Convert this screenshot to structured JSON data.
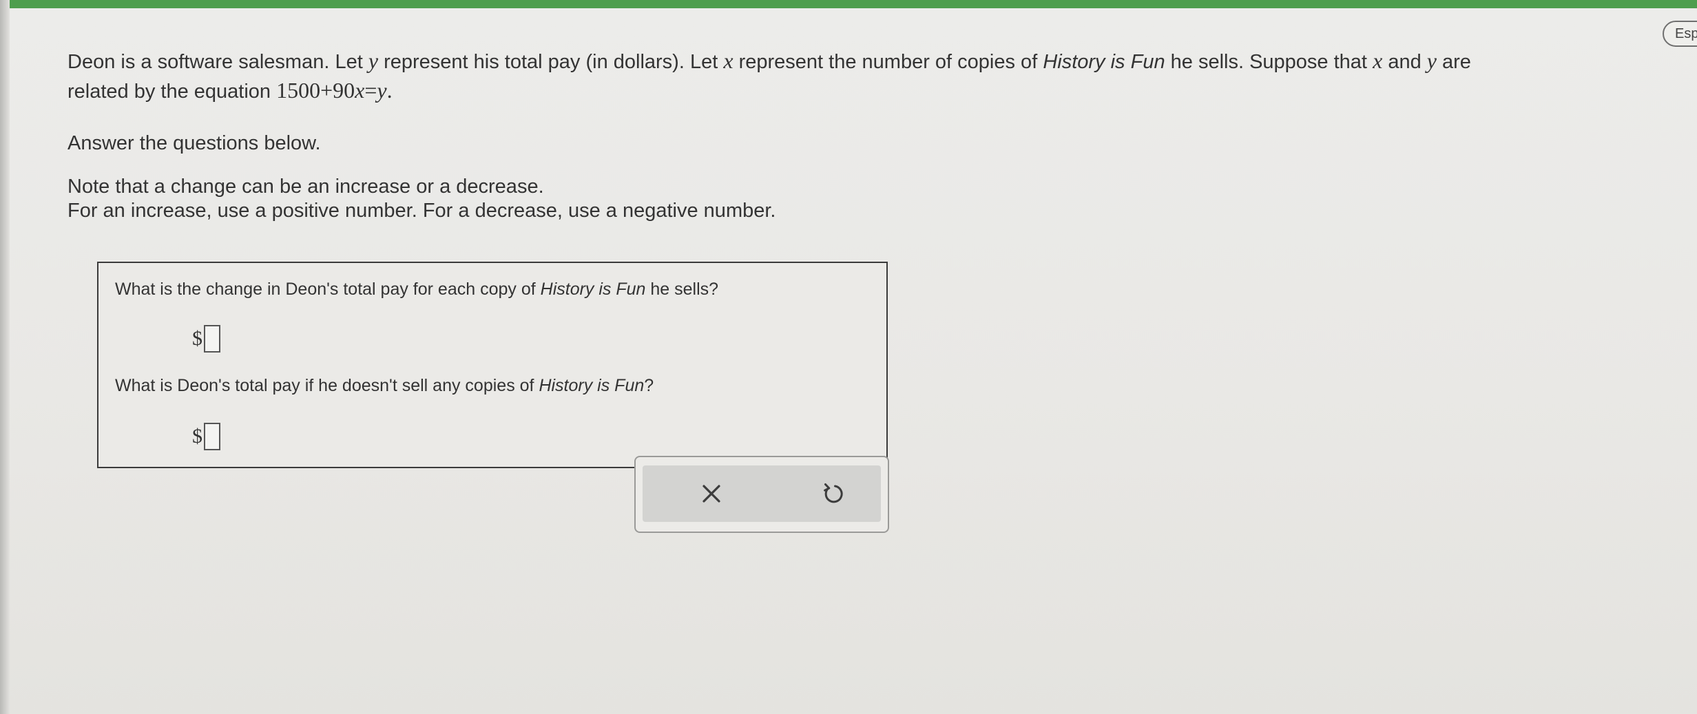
{
  "header": {
    "espanol_label": "Esp"
  },
  "problem": {
    "p1_a": "Deon is a software salesman. Let ",
    "var_y": "y",
    "p1_b": " represent his total pay (in dollars). Let ",
    "var_x": "x",
    "p1_c": " represent the number of copies of ",
    "product": "History is Fun",
    "p1_d": " he sells. Suppose that ",
    "p1_e": " and ",
    "p1_f": " are",
    "p2_a": "related by the equation ",
    "equation_left": "1500+90",
    "equation_x": "x",
    "equation_eq": "=",
    "equation_y": "y",
    "equation_end": ".",
    "instruction": "Answer the questions below.",
    "note_line1": "Note that a change can be an increase or a decrease.",
    "note_line2": "For an increase, use a positive number. For a decrease, use a negative number."
  },
  "questions": [
    {
      "text_a": "What is the change in Deon's total pay for each copy of ",
      "product": "History is Fun",
      "text_b": " he sells?",
      "prefix": "$",
      "value": ""
    },
    {
      "text_a": "What is Deon's total pay if he doesn't sell any copies of ",
      "product": "History is Fun",
      "text_b": "?",
      "prefix": "$",
      "value": ""
    }
  ],
  "actions": {
    "clear_icon": "close-icon",
    "undo_icon": "undo-icon"
  }
}
